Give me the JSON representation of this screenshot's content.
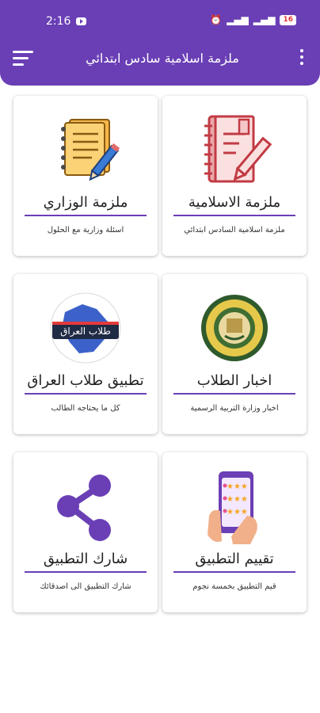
{
  "status_bar": {
    "time": "2:16",
    "battery": "16"
  },
  "app_bar": {
    "title": "ملزمة اسلامية سادس ابتدائي"
  },
  "colors": {
    "primary": "#6a3fb5"
  },
  "cards": [
    {
      "title": "ملزمة الاسلامية",
      "subtitle": "ملزمة اسلامية السادس ابتدائي",
      "icon": "notebook-pencil-icon"
    },
    {
      "title": "ملزمة الوزاري",
      "subtitle": "اسئلة وزارية مع الحلول",
      "icon": "notepad-pencil-icon"
    },
    {
      "title": "اخبار الطلاب",
      "subtitle": "اخبار وزارة التربية الرسمية",
      "icon": "ministry-seal-icon"
    },
    {
      "title": "تطبيق طلاب العراق",
      "subtitle": "كل ما يحتاجه الطالب",
      "icon": "iraq-map-logo-icon",
      "logo_text": "طلاب العراق"
    },
    {
      "title": "تقييم التطبيق",
      "subtitle": "قيم التطبيق بخمسة نجوم",
      "icon": "rating-phone-icon"
    },
    {
      "title": "شارك التطبيق",
      "subtitle": "شارك التطبيق الى اصدقائك",
      "icon": "share-icon"
    }
  ]
}
